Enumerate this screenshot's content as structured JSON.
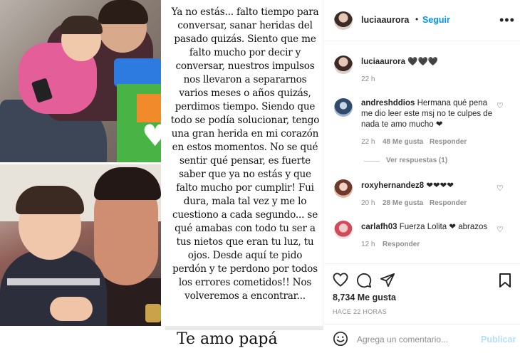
{
  "post": {
    "letter": "Ya no estás... falto tiempo para conversar, sanar heridas del pasado quizás. Siento que me falto mucho por decir y conversar, nuestros impulsos nos llevaron a separarnos varios meses o años quizás, perdimos tiempo. Siendo que todo se podía solucionar, tengo una gran herida en mi corazón en estos momentos. No se qué sentir qué pensar, es fuerte saber que ya no estás y que falto mucho por cumplir! Fui dura, mala tal vez y me lo cuestiono a cada segundo... se qué amabas con todo tu ser a tus nietos que eran tu luz, tu ojos. Desde aquí te pido perdón y te perdono por todos los errores cometidos!! Nos volveremos a encontrar...",
    "footer_phrase": "Te amo papá",
    "heart_glyph": "♥"
  },
  "header": {
    "username": "luciaaurora",
    "separator": "•",
    "follow_label": "Seguir",
    "more_glyph": "•••"
  },
  "caption": {
    "username": "luciaaurora",
    "text": "🖤🖤🖤",
    "time": "22 h"
  },
  "comments": [
    {
      "username": "andreshddios",
      "text": "Hermana qué pena me dio leer este msj no te culpes de nada te amo mucho ❤",
      "time": "22 h",
      "likes": "48 Me gusta",
      "reply": "Responder",
      "view_replies": "Ver respuestas (1)"
    },
    {
      "username": "roxyhernandez8",
      "text": "❤❤❤❤",
      "time": "20 h",
      "likes": "28 Me gusta",
      "reply": "Responder"
    },
    {
      "username": "carlafh03",
      "text": "Fuerza Lolita ❤ abrazos",
      "time": "12 h",
      "reply": "Responder"
    }
  ],
  "actions": {
    "likes_count": "8,734 Me gusta",
    "time_ago": "HACE 22 HORAS"
  },
  "add_comment": {
    "placeholder": "Agrega un comentario...",
    "publish_label": "Publicar"
  },
  "colors": {
    "accent": "#0095f6",
    "publish_disabled": "#b2dffc",
    "muted": "#8e8e8e"
  }
}
